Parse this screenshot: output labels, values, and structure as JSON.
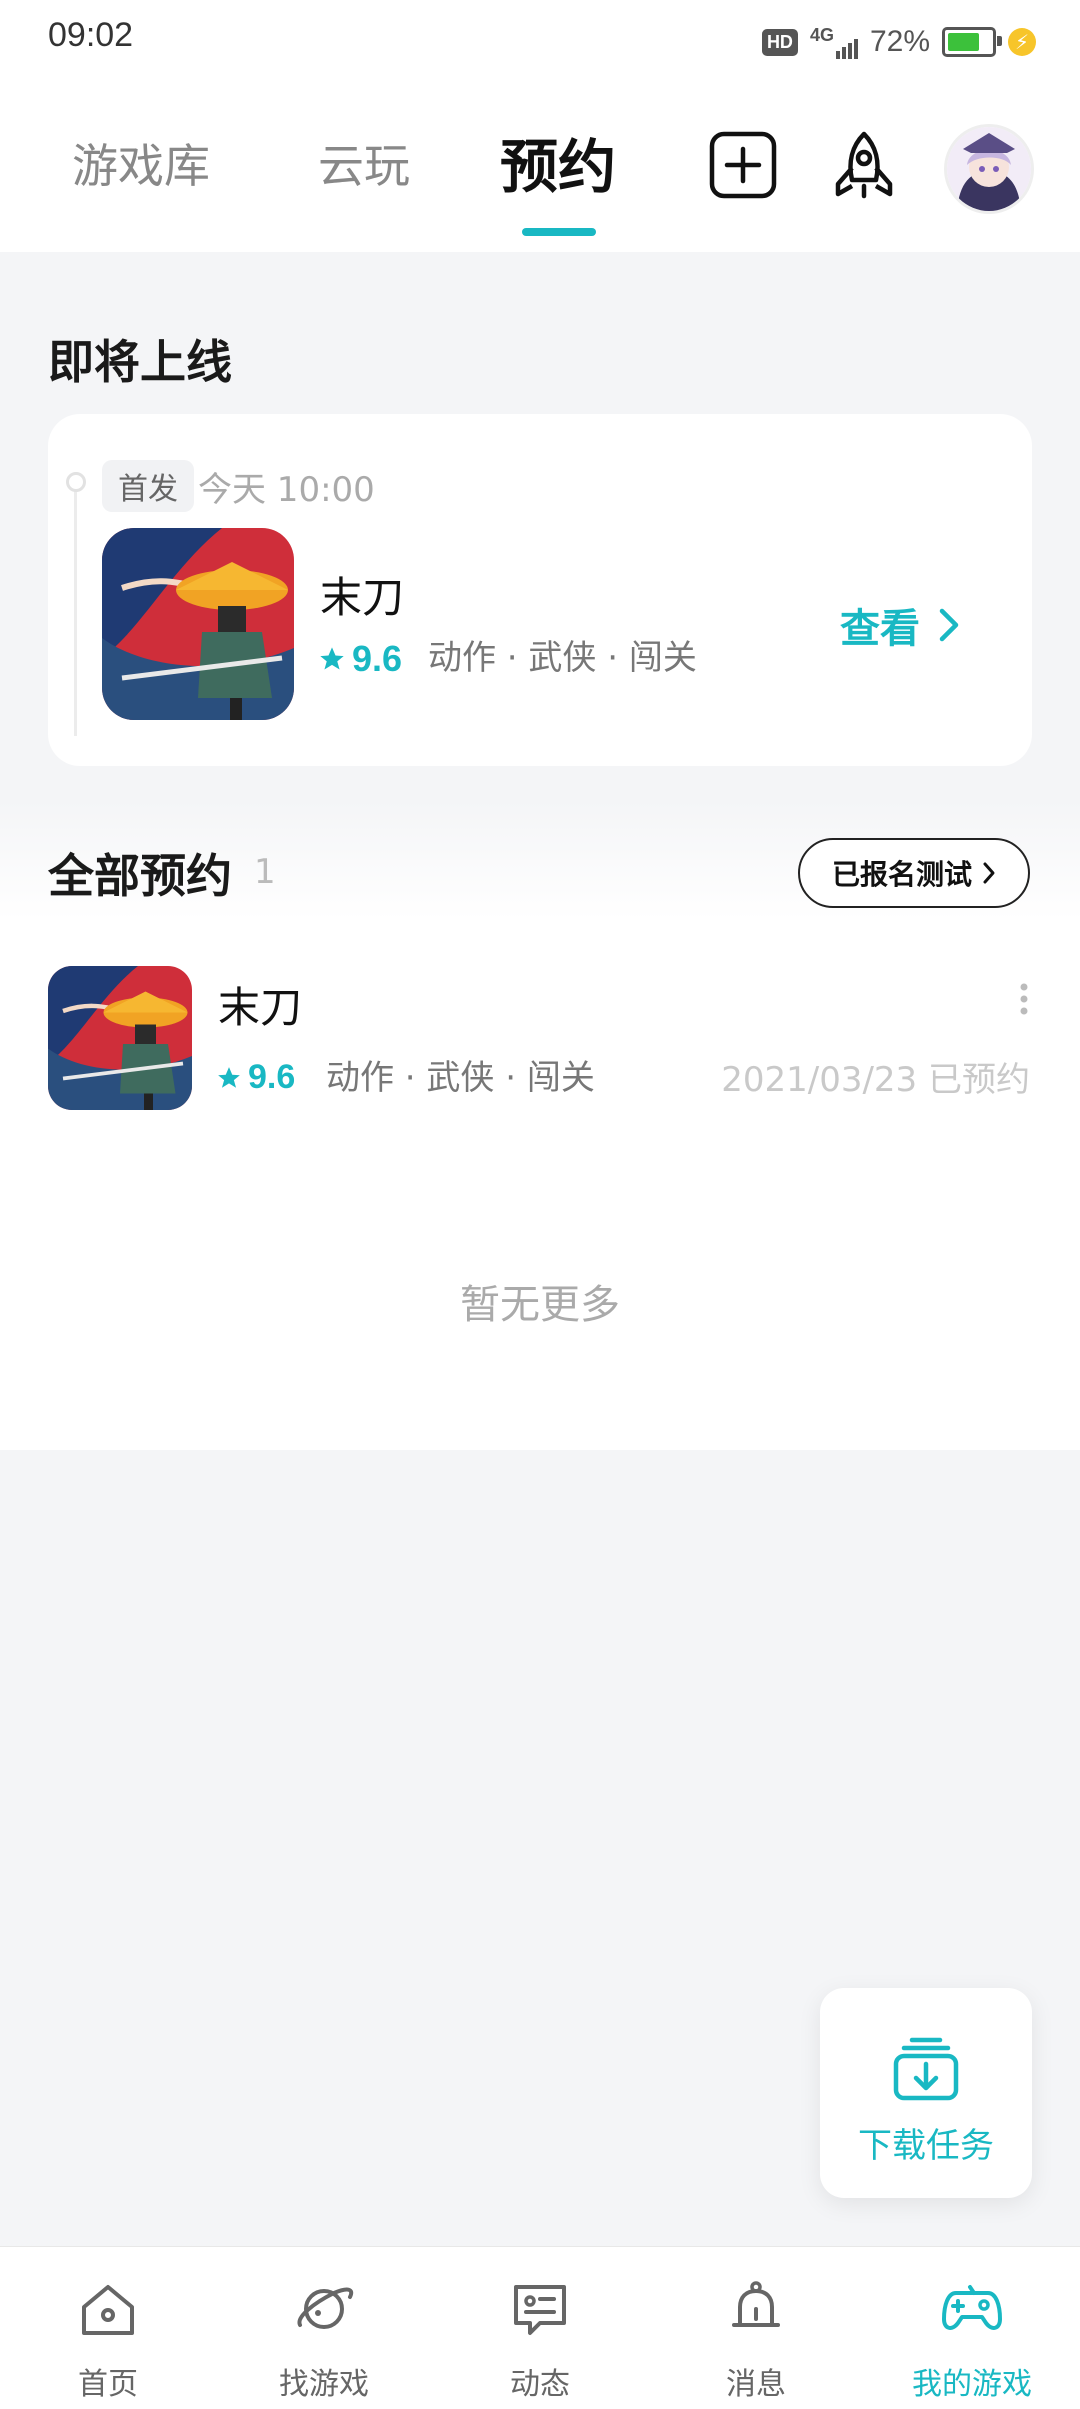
{
  "status_bar": {
    "time": "09:02",
    "hd": "HD",
    "network": "4G",
    "battery": "72%"
  },
  "top_tabs": [
    {
      "label": "游戏库"
    },
    {
      "label": "云玩"
    },
    {
      "label": "预约"
    }
  ],
  "upcoming": {
    "section_title": "即将上线",
    "badge": "首发",
    "time": "今天 10:00",
    "game_name": "末刀",
    "rating": "9.6",
    "genres": "动作 · 武侠 · 闯关",
    "view_label": "查看"
  },
  "all_reservations": {
    "section_title": "全部预约",
    "count": "1",
    "signed_test_label": "已报名测试",
    "items": [
      {
        "name": "末刀",
        "rating": "9.6",
        "genres": "动作 · 武侠 · 闯关",
        "status": "2021/03/23 已预约"
      }
    ],
    "no_more": "暂无更多"
  },
  "download_tasks": {
    "label": "下载任务"
  },
  "bottom_nav": [
    {
      "label": "首页"
    },
    {
      "label": "找游戏"
    },
    {
      "label": "动态"
    },
    {
      "label": "消息"
    },
    {
      "label": "我的游戏"
    }
  ],
  "colors": {
    "accent": "#19b8c3",
    "background": "#f4f5f7"
  }
}
